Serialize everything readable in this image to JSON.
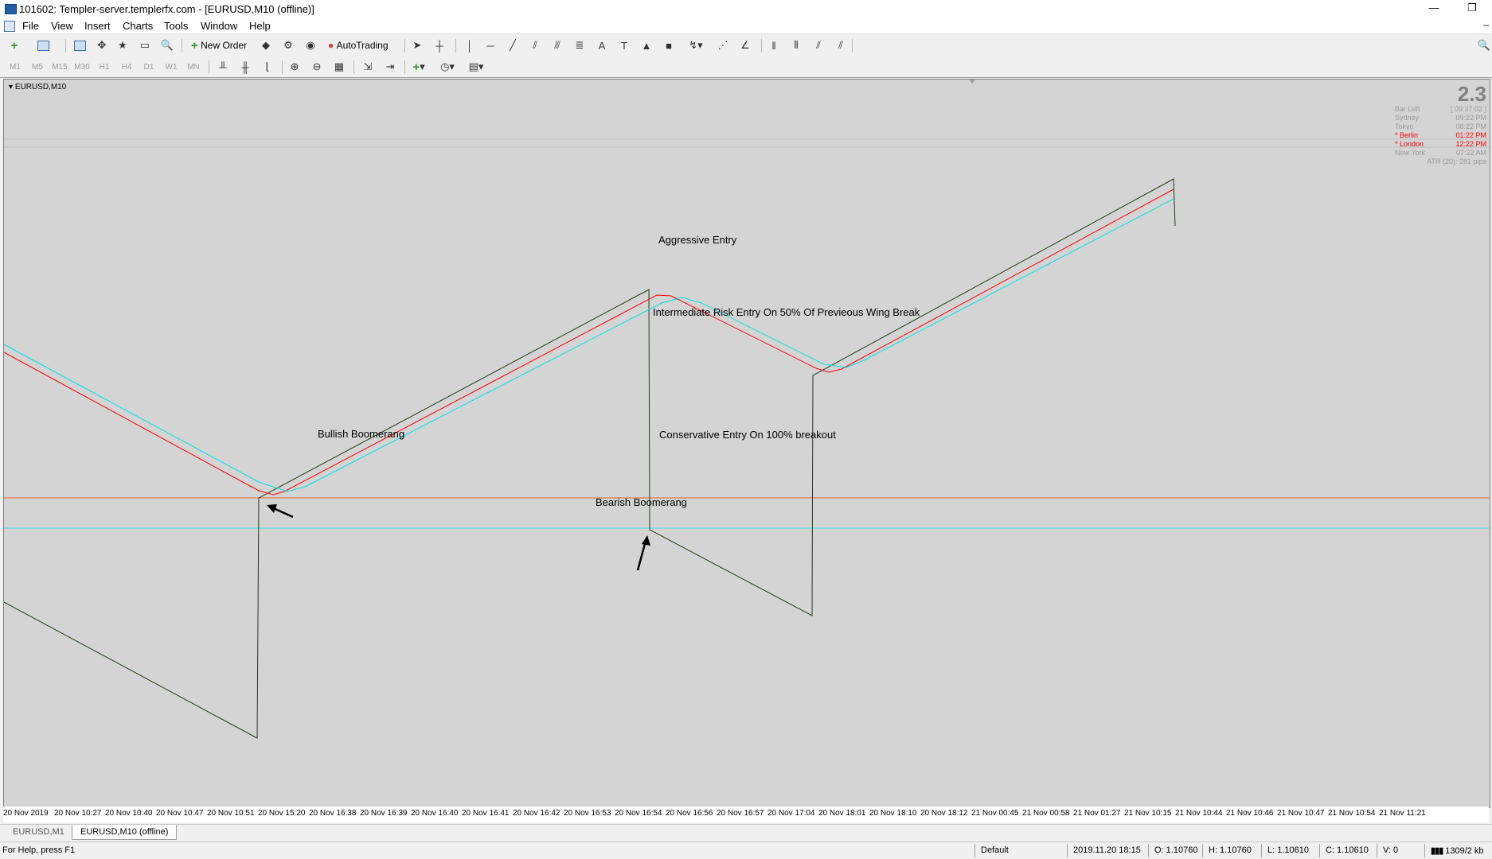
{
  "window": {
    "title": "101602: Templer-server.templerfx.com - [EURUSD,M10 (offline)]",
    "min_glyph": "—",
    "restore_glyph": "❐"
  },
  "menu": [
    "File",
    "View",
    "Insert",
    "Charts",
    "Tools",
    "Window",
    "Help"
  ],
  "toolbar": {
    "new_order": "New Order",
    "autotrading": "AutoTrading"
  },
  "timeframes": [
    "M1",
    "M5",
    "M15",
    "M30",
    "H1",
    "H4",
    "D1",
    "W1",
    "MN"
  ],
  "chart": {
    "symbol_label": "EURUSD,M10",
    "info": {
      "big_value": "2.3",
      "rows": [
        {
          "label": "Bar Left",
          "value": "[ 09:37:02 ]",
          "active": false
        },
        {
          "label": "Sydney",
          "value": "09:22 PM",
          "active": false
        },
        {
          "label": "Tokyo",
          "value": "08:22 PM",
          "active": false
        },
        {
          "label": "* Berlin",
          "value": "01:22 PM",
          "active": true
        },
        {
          "label": "* London",
          "value": "12:22 PM",
          "active": true
        },
        {
          "label": "New York",
          "value": "07:22 AM",
          "active": false
        }
      ],
      "atr": "ATR (20): 281 pips"
    },
    "annotations": {
      "bullish": "Bullish Boomerang",
      "bearish": "Bearish Boomerang",
      "aggressive": "Aggressive Entry",
      "intermediate": "Intermediate Risk Entry On 50% Of Previeous Wing Break",
      "conservative": "Conservative Entry On 100% breakout"
    },
    "colors": {
      "price": "#1e3d14",
      "ma_red": "#ff0000",
      "ma_cyan": "#00e0e8",
      "hline_orange": "#e26030",
      "hline_cyan": "#3fe0e0",
      "background": "#d4d4d4"
    },
    "x_axis": [
      "20 Nov 2019",
      "20 Nov 10:27",
      "20 Nov 10:40",
      "20 Nov 10:47",
      "20 Nov 10:51",
      "20 Nov 15:20",
      "20 Nov 16:38",
      "20 Nov 16:39",
      "20 Nov 16:40",
      "20 Nov 16:41",
      "20 Nov 16:42",
      "20 Nov 16:53",
      "20 Nov 16:54",
      "20 Nov 16:56",
      "20 Nov 16:57",
      "20 Nov 17:04",
      "20 Nov 18:01",
      "20 Nov 18:10",
      "20 Nov 18:12",
      "21 Nov 00:45",
      "21 Nov 00:58",
      "21 Nov 01:27",
      "21 Nov 10:15",
      "21 Nov 10:44",
      "21 Nov 10:46",
      "21 Nov 10:47",
      "21 Nov 10:54",
      "21 Nov 11:21"
    ]
  },
  "tabs": [
    "EURUSD,M1",
    "EURUSD,M10 (offline)"
  ],
  "status": {
    "help": "For Help, press F1",
    "profile": "Default",
    "datetime": "2019.11.20 18:15",
    "open": "O: 1.10760",
    "high": "H: 1.10760",
    "low": "L: 1.10610",
    "close": "C: 1.10610",
    "volume": "V: 0",
    "traffic": "1309/2 kb"
  }
}
